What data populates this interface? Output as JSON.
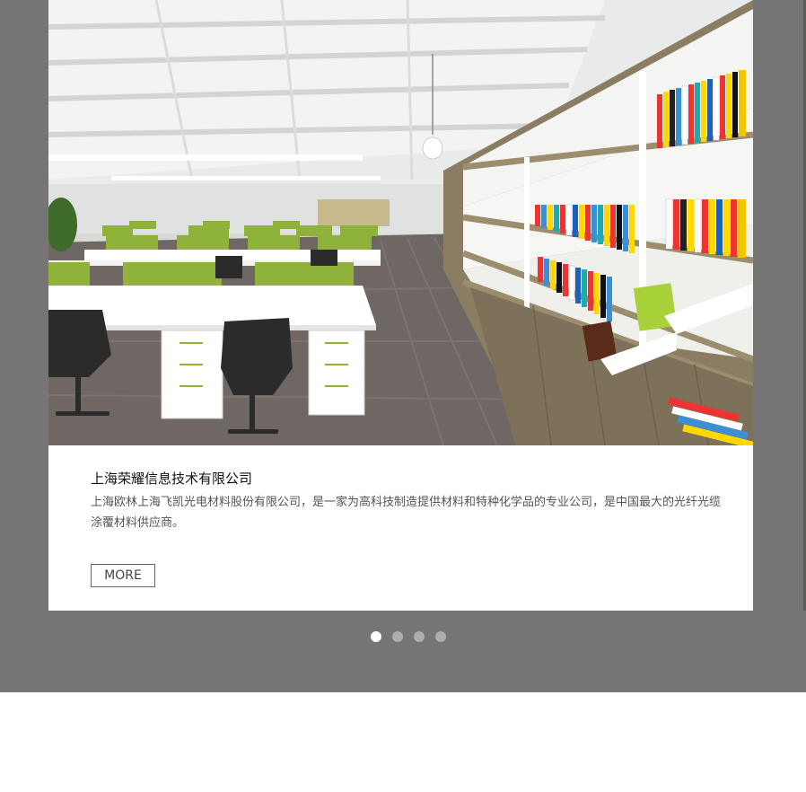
{
  "slide": {
    "image_alt": "office interior with bookshelves",
    "title": "上海荣耀信息技术有限公司",
    "description": "上海欧林上海飞凯光电材料股份有限公司，是一家为高科技制造提供材料和特种化学品的专业公司，是中国最大的光纤光缆涂覆材料供应商。",
    "more_label": "MORE"
  },
  "pagination": {
    "count": 4,
    "active_index": 0
  },
  "colors": {
    "band": "#767474",
    "card": "#ffffff",
    "dot_active": "#ffffff",
    "dot_inactive": "#adadad",
    "desk_screen_green": "#8fb23a",
    "floor": "#6e6763",
    "shelf_wood": "#8a7d63"
  }
}
